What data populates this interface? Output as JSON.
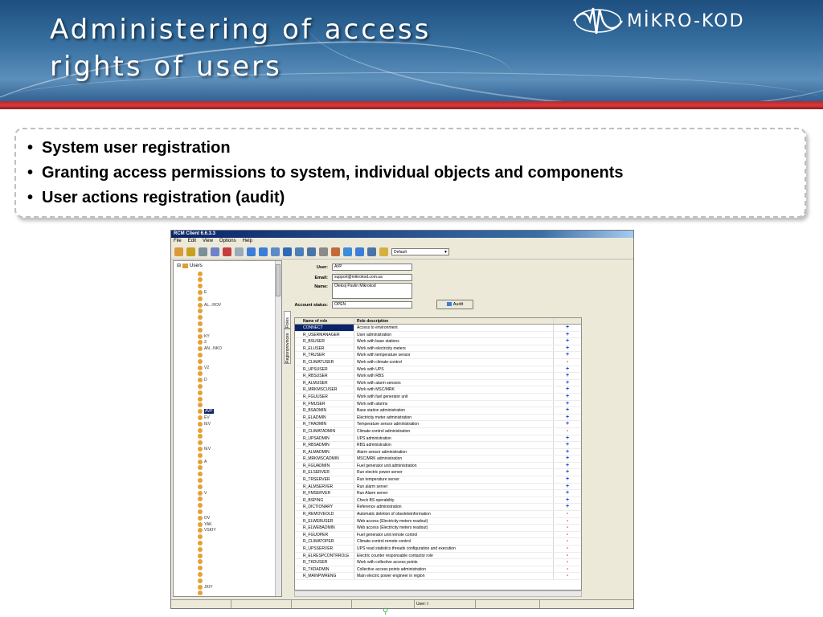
{
  "slide": {
    "title_lines": [
      "Administering of access",
      "rights of users"
    ],
    "logo_text": "MİKRO-KOD",
    "bullets": [
      "System user registration",
      "Granting access permissions to system, individual objects and components",
      "User actions registration (audit)"
    ]
  },
  "app": {
    "window_title": "RCM Client 6.6.3.3",
    "menu": [
      "File",
      "Edit",
      "View",
      "Options",
      "Help"
    ],
    "toolbar_select": "Default",
    "tree": {
      "root_label": "Users",
      "items": [
        {
          "label": "",
          "selected": false
        },
        {
          "label": "",
          "selected": false
        },
        {
          "label": "",
          "selected": false
        },
        {
          "label": "E",
          "selected": false
        },
        {
          "label": "",
          "selected": false
        },
        {
          "label": "AL...ROV",
          "selected": false
        },
        {
          "label": "",
          "selected": false
        },
        {
          "label": "",
          "selected": false
        },
        {
          "label": "",
          "selected": false
        },
        {
          "label": "",
          "selected": false
        },
        {
          "label": "KY",
          "selected": false
        },
        {
          "label": "3",
          "selected": false
        },
        {
          "label": "AN...NKO",
          "selected": false
        },
        {
          "label": "",
          "selected": false
        },
        {
          "label": "",
          "selected": false
        },
        {
          "label": "V2",
          "selected": false
        },
        {
          "label": "",
          "selected": false
        },
        {
          "label": "D",
          "selected": false
        },
        {
          "label": "",
          "selected": false
        },
        {
          "label": "",
          "selected": false
        },
        {
          "label": "",
          "selected": false
        },
        {
          "label": "",
          "selected": false
        },
        {
          "label": "AVP",
          "selected": true
        },
        {
          "label": "EV",
          "selected": false
        },
        {
          "label": "IEV",
          "selected": false
        },
        {
          "label": "",
          "selected": false
        },
        {
          "label": "",
          "selected": false
        },
        {
          "label": "",
          "selected": false
        },
        {
          "label": "IEV",
          "selected": false
        },
        {
          "label": "",
          "selected": false
        },
        {
          "label": "A",
          "selected": false
        },
        {
          "label": "",
          "selected": false
        },
        {
          "label": "",
          "selected": false
        },
        {
          "label": "",
          "selected": false
        },
        {
          "label": "",
          "selected": false
        },
        {
          "label": "V",
          "selected": false
        },
        {
          "label": "",
          "selected": false
        },
        {
          "label": "",
          "selected": false
        },
        {
          "label": "",
          "selected": false
        },
        {
          "label": "OV",
          "selected": false
        },
        {
          "label": "YAK",
          "selected": false
        },
        {
          "label": "VSKIY",
          "selected": false
        },
        {
          "label": "",
          "selected": false
        },
        {
          "label": "",
          "selected": false
        },
        {
          "label": "",
          "selected": false
        },
        {
          "label": "",
          "selected": false
        },
        {
          "label": "",
          "selected": false
        },
        {
          "label": "",
          "selected": false
        },
        {
          "label": "",
          "selected": false
        },
        {
          "label": "",
          "selected": false
        },
        {
          "label": "JKIY",
          "selected": false
        },
        {
          "label": "",
          "selected": false
        },
        {
          "label": "",
          "selected": false
        }
      ]
    },
    "side_tabs": [
      "Roles",
      "Regionprovinces"
    ],
    "form": {
      "user_label": "User:",
      "user_value": "AVP",
      "email_label": "Email:",
      "email_value": "support@mikrokod.com.ua",
      "name_label": "Name:",
      "name_value": "Oleksij Pavlin Mikrokod",
      "status_label": "Account status:",
      "status_value": "OPEN",
      "audit_button": "Audit"
    },
    "roles_table": {
      "headers": [
        "Name of role",
        "Role description"
      ],
      "rows": [
        {
          "role": "CONNECT",
          "desc": "Access to environment",
          "flag": "+",
          "selected": true
        },
        {
          "role": "R_USERMANAGER",
          "desc": "User administration",
          "flag": "+"
        },
        {
          "role": "R_BSUSER",
          "desc": "Work with base stations",
          "flag": "+"
        },
        {
          "role": "R_ELUSER",
          "desc": "Work with electricity meters",
          "flag": "+"
        },
        {
          "role": "R_TRUSER",
          "desc": "Work with temperature sensor",
          "flag": "+"
        },
        {
          "role": "R_CLIMATUSER",
          "desc": "Work with climate-control",
          "flag": "-"
        },
        {
          "role": "R_UPSUSER",
          "desc": "Work with UPS",
          "flag": "+"
        },
        {
          "role": "R_RBSUSER",
          "desc": "Work with RBS",
          "flag": "+"
        },
        {
          "role": "R_ALMUSER",
          "desc": "Work with alarm sensors",
          "flag": "+"
        },
        {
          "role": "R_MRKMSCUSER",
          "desc": "Work with MSC/MRK",
          "flag": "+"
        },
        {
          "role": "R_FGUUSER",
          "desc": "Work with fuel generator unit",
          "flag": "+"
        },
        {
          "role": "R_FMUSER",
          "desc": "Work with alarms",
          "flag": "+"
        },
        {
          "role": "R_BSADMIN",
          "desc": "Base station administration",
          "flag": "+"
        },
        {
          "role": "R_ELADMIN",
          "desc": "Electricity meter administration",
          "flag": "+"
        },
        {
          "role": "R_TRADMIN",
          "desc": "Temperature sensor administration",
          "flag": "+"
        },
        {
          "role": "R_CLIMATADMIN",
          "desc": "Climate-control administration",
          "flag": "-"
        },
        {
          "role": "R_UPSADMIN",
          "desc": "UPS administration",
          "flag": "+"
        },
        {
          "role": "R_RBSADMIN",
          "desc": "RBS administration",
          "flag": "+"
        },
        {
          "role": "R_ALMADMIN",
          "desc": "Alarm sensor administration",
          "flag": "+"
        },
        {
          "role": "R_MRKMSCADMIN",
          "desc": "MSC/MRK administration",
          "flag": "+"
        },
        {
          "role": "R_FGUADMIN",
          "desc": "Fuel generator unit administration",
          "flag": "+"
        },
        {
          "role": "R_ELSERVER",
          "desc": "Run electric power server",
          "flag": "+"
        },
        {
          "role": "R_TRSERVER",
          "desc": "Run temperature server",
          "flag": "+"
        },
        {
          "role": "R_ALMSERVER",
          "desc": "Run alarm server",
          "flag": "+"
        },
        {
          "role": "R_FMSERVER",
          "desc": "Run Alarm server",
          "flag": "+"
        },
        {
          "role": "R_BSPING",
          "desc": "Check BS operability",
          "flag": "+"
        },
        {
          "role": "R_DICTIONARY",
          "desc": "Reference administration",
          "flag": "+"
        },
        {
          "role": "R_REMOVEOLD",
          "desc": "Automatic deletion of obsoleteinformation",
          "flag": "-"
        },
        {
          "role": "R_ELWEBUSER",
          "desc": "Web access (Electricity meters readout)",
          "flag": "-"
        },
        {
          "role": "R_ELWEBADMIN",
          "desc": "Web access (Electricity meters readout)",
          "flag": "-"
        },
        {
          "role": "R_FGUOPER",
          "desc": "Fuel generator unit remote control",
          "flag": "-"
        },
        {
          "role": "R_CLIMATOPER",
          "desc": "Climate-control remote control",
          "flag": "-"
        },
        {
          "role": "R_UPSSERVER",
          "desc": "UPS read statistics threads configuration and execution",
          "flag": "-"
        },
        {
          "role": "R_ELRESPCONTRROLE",
          "desc": "Electric counter responsable contactor role",
          "flag": "-"
        },
        {
          "role": "R_TKDUSER",
          "desc": "Work with collective access points",
          "flag": "-"
        },
        {
          "role": "R_TKDADMIN",
          "desc": "Collective access points administration",
          "flag": "-"
        },
        {
          "role": "R_MAINPWRENG",
          "desc": "Main electric power engineer in region",
          "flag": "-"
        }
      ]
    },
    "statusbar": {
      "user_label": "User: t"
    }
  },
  "colors": {
    "header_blue": "#3a73a3",
    "stripe_red": "#c42f31",
    "plus_color": "#1a2fd6",
    "minus_color": "#d41f1f",
    "selection": "#0a246a"
  }
}
